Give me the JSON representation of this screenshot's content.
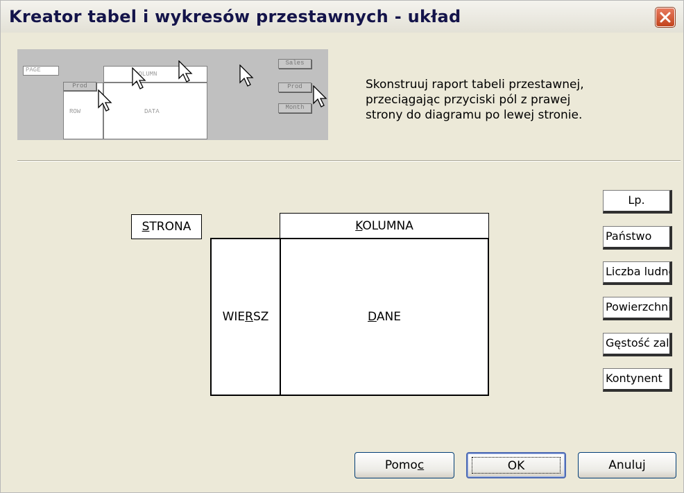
{
  "window": {
    "title": "Kreator tabel i wykresów przestawnych - układ"
  },
  "preview": {
    "page_label": "PAGE",
    "column_label": "COLUMN",
    "row_label": "ROW",
    "data_label": "DATA",
    "prod_label": "Prod",
    "sales_label": "Sales",
    "month_label": "Month"
  },
  "instructions": {
    "line1": "Skonstruuj raport tabeli przestawnej,",
    "line2": "przeciągając przyciski pól z prawej",
    "line3": "strony do diagramu po lewej stronie."
  },
  "layout": {
    "strona": {
      "key": "S",
      "rest": "TRONA"
    },
    "kolumna": {
      "key": "K",
      "rest": "OLUMNA"
    },
    "wiersz": {
      "pre": "WIE",
      "key": "R",
      "rest": "SZ"
    },
    "dane": {
      "key": "D",
      "rest": "ANE"
    }
  },
  "fields": [
    "Lp.",
    "Państwo",
    "Liczba ludności",
    "Powierzchnia",
    "Gęstość zaludnienia",
    "Kontynent"
  ],
  "buttons": {
    "help": {
      "pre": "Pomo",
      "key": "c"
    },
    "ok": "OK",
    "cancel": "Anuluj"
  }
}
